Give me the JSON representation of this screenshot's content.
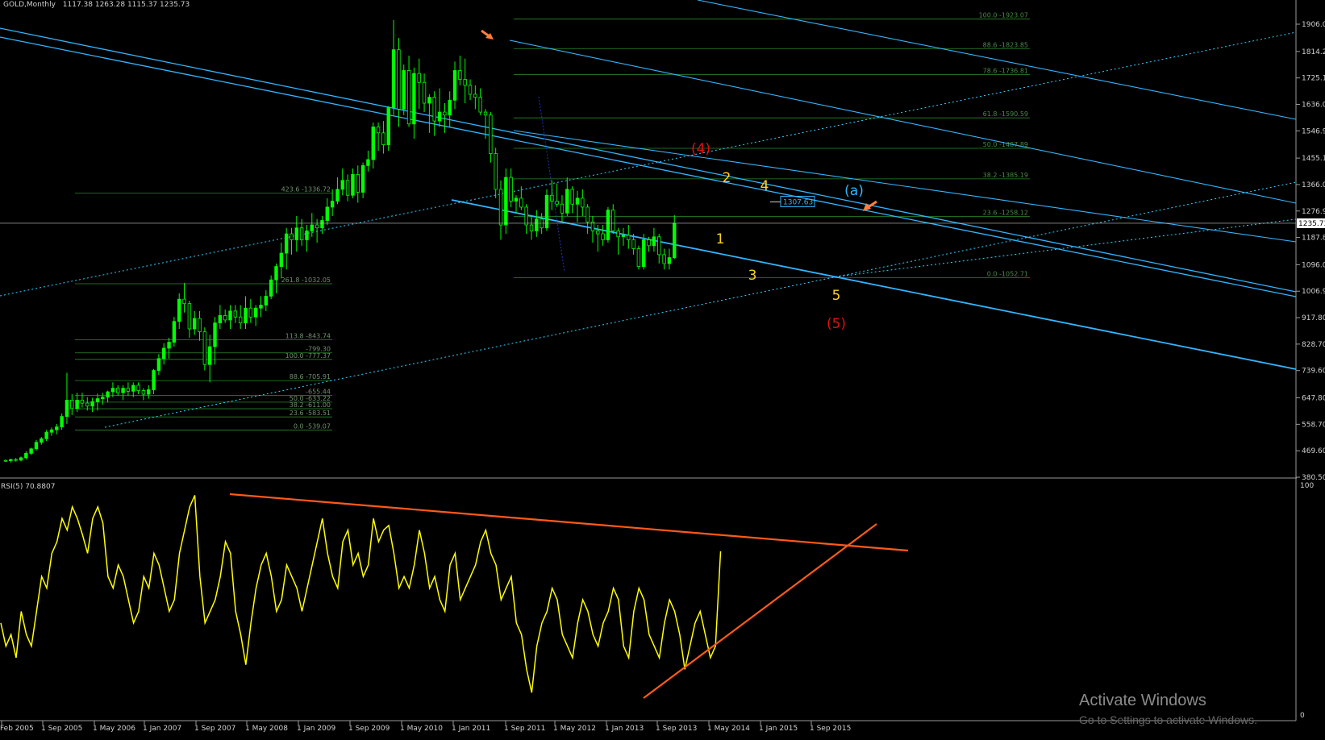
{
  "header": {
    "symbol_title": "GOLD,Monthly",
    "ohlc": "1117.38 1263.28 1115.37 1235.73"
  },
  "chart_data": [
    {
      "type": "candlestick",
      "title": "GOLD,Monthly",
      "price_axis_ticks": [
        "1906.00",
        "1814.20",
        "1725.10",
        "1636.00",
        "1546.90",
        "1455.10",
        "1366.00",
        "1276.90",
        "1187.80",
        "1096.00",
        "1006.90",
        "917.80",
        "828.70",
        "739.60",
        "647.80",
        "558.70",
        "469.60",
        "380.50"
      ],
      "current_price_label": "1235.73",
      "ylim": [
        380.5,
        1906.0
      ],
      "time_axis_ticks": [
        "Feb 2005",
        "1 Sep 2005",
        "1 May 2006",
        "1 Jan 2007",
        "1 Sep 2007",
        "1 May 2008",
        "1 Jan 2009",
        "1 Sep 2009",
        "1 May 2010",
        "1 Jan 2011",
        "1 Sep 2011",
        "1 May 2012",
        "1 Jan 2013",
        "1 Sep 2013",
        "1 May 2014",
        "1 Jan 2015",
        "1 Sep 2015"
      ],
      "fib_left": [
        {
          "label": "423.6 -1336.72",
          "price": 1336.72
        },
        {
          "label": "261.8 -1032.05",
          "price": 1032.05
        },
        {
          "label": "113.8 -843.74",
          "price": 843.74
        },
        {
          "label": "-799.30",
          "price": 799.3
        },
        {
          "label": "100.0 -777.37",
          "price": 777.37
        },
        {
          "label": "88.6 -705.91",
          "price": 705.91
        },
        {
          "label": "-655.44",
          "price": 655.44
        },
        {
          "label": "50.0 -633.22",
          "price": 633.22
        },
        {
          "label": "38.2 -611.00",
          "price": 611.0
        },
        {
          "label": "23.6 -583.51",
          "price": 583.51
        },
        {
          "label": "0.0 -539.07",
          "price": 539.07
        }
      ],
      "fib_right": [
        {
          "label": "100.0 -1923.07",
          "price": 1923.07
        },
        {
          "label": "88.6 -1823.85",
          "price": 1823.85
        },
        {
          "label": "78.6 -1736.81",
          "price": 1736.81
        },
        {
          "label": "61.8 -1590.59",
          "price": 1590.59
        },
        {
          "label": "50.0 -1487.89",
          "price": 1487.89
        },
        {
          "label": "38.2 -1385.19",
          "price": 1385.19
        },
        {
          "label": "23.6 -1258.12",
          "price": 1258.12
        },
        {
          "label": "0.0 -1052.71",
          "price": 1052.71
        }
      ],
      "price_boxes": [
        "1307.63"
      ],
      "wave_labels": [
        {
          "text": "(4)",
          "color": "#e01010"
        },
        {
          "text": "(5)",
          "color": "#e01010"
        },
        {
          "text": "(a)",
          "color": "#33b5ff"
        },
        {
          "text": "1",
          "color": "#ffd21f"
        },
        {
          "text": "2",
          "color": "#ffd21f"
        },
        {
          "text": "3",
          "color": "#ffd21f"
        },
        {
          "text": "4",
          "color": "#ffd21f"
        },
        {
          "text": "5",
          "color": "#ffd21f"
        }
      ],
      "candles": [
        [
          437,
          440,
          432,
          436
        ],
        [
          436,
          443,
          430,
          440
        ],
        [
          440,
          445,
          433,
          438
        ],
        [
          438,
          450,
          434,
          446
        ],
        [
          446,
          468,
          440,
          461
        ],
        [
          461,
          480,
          455,
          476
        ],
        [
          476,
          506,
          470,
          498
        ],
        [
          498,
          516,
          490,
          510
        ],
        [
          510,
          540,
          502,
          532
        ],
        [
          532,
          548,
          520,
          540
        ],
        [
          540,
          560,
          525,
          550
        ],
        [
          550,
          595,
          540,
          585
        ],
        [
          585,
          732,
          560,
          640
        ],
        [
          640,
          660,
          590,
          612
        ],
        [
          612,
          665,
          600,
          640
        ],
        [
          640,
          665,
          615,
          630
        ],
        [
          630,
          650,
          605,
          620
        ],
        [
          620,
          648,
          600,
          635
        ],
        [
          635,
          662,
          605,
          645
        ],
        [
          645,
          665,
          625,
          650
        ],
        [
          650,
          672,
          632,
          668
        ],
        [
          668,
          700,
          650,
          680
        ],
        [
          680,
          690,
          655,
          665
        ],
        [
          665,
          690,
          640,
          680
        ],
        [
          680,
          700,
          655,
          670
        ],
        [
          670,
          700,
          650,
          690
        ],
        [
          690,
          700,
          660,
          672
        ],
        [
          672,
          680,
          640,
          660
        ],
        [
          660,
          690,
          645,
          675
        ],
        [
          675,
          745,
          660,
          740
        ],
        [
          740,
          795,
          725,
          780
        ],
        [
          780,
          832,
          760,
          815
        ],
        [
          815,
          850,
          780,
          835
        ],
        [
          835,
          920,
          820,
          905
        ],
        [
          905,
          1000,
          880,
          980
        ],
        [
          980,
          1035,
          935,
          965
        ],
        [
          965,
          975,
          850,
          880
        ],
        [
          880,
          940,
          860,
          915
        ],
        [
          915,
          940,
          840,
          870
        ],
        [
          870,
          885,
          740,
          760
        ],
        [
          760,
          860,
          700,
          820
        ],
        [
          820,
          920,
          760,
          900
        ],
        [
          900,
          960,
          880,
          925
        ],
        [
          925,
          945,
          900,
          910
        ],
        [
          910,
          960,
          880,
          940
        ],
        [
          940,
          960,
          900,
          920
        ],
        [
          920,
          960,
          880,
          900
        ],
        [
          900,
          990,
          880,
          950
        ],
        [
          950,
          980,
          900,
          920
        ],
        [
          920,
          960,
          890,
          950
        ],
        [
          950,
          990,
          920,
          960
        ],
        [
          960,
          1010,
          940,
          990
        ],
        [
          990,
          1060,
          980,
          1045
        ],
        [
          1045,
          1100,
          1000,
          1090
        ],
        [
          1090,
          1170,
          1050,
          1135
        ],
        [
          1135,
          1220,
          1080,
          1200
        ],
        [
          1200,
          1220,
          1130,
          1180
        ],
        [
          1180,
          1260,
          1140,
          1220
        ],
        [
          1220,
          1250,
          1160,
          1180
        ],
        [
          1180,
          1230,
          1140,
          1210
        ],
        [
          1210,
          1270,
          1190,
          1230
        ],
        [
          1230,
          1250,
          1170,
          1220
        ],
        [
          1220,
          1260,
          1200,
          1245
        ],
        [
          1245,
          1320,
          1230,
          1290
        ],
        [
          1290,
          1350,
          1260,
          1310
        ],
        [
          1310,
          1390,
          1300,
          1350
        ],
        [
          1350,
          1420,
          1330,
          1380
        ],
        [
          1380,
          1400,
          1310,
          1330
        ],
        [
          1330,
          1420,
          1320,
          1400
        ],
        [
          1400,
          1430,
          1305,
          1340
        ],
        [
          1340,
          1440,
          1320,
          1430
        ],
        [
          1430,
          1480,
          1410,
          1450
        ],
        [
          1450,
          1575,
          1420,
          1560
        ],
        [
          1560,
          1575,
          1480,
          1540
        ],
        [
          1540,
          1580,
          1470,
          1500
        ],
        [
          1500,
          1630,
          1480,
          1625
        ],
        [
          1625,
          1920,
          1600,
          1820
        ],
        [
          1820,
          1860,
          1560,
          1620
        ],
        [
          1620,
          1770,
          1600,
          1750
        ],
        [
          1750,
          1800,
          1560,
          1570
        ],
        [
          1570,
          1760,
          1520,
          1740
        ],
        [
          1740,
          1790,
          1620,
          1710
        ],
        [
          1710,
          1740,
          1610,
          1640
        ],
        [
          1640,
          1670,
          1540,
          1660
        ],
        [
          1660,
          1680,
          1530,
          1580
        ],
        [
          1580,
          1690,
          1560,
          1610
        ],
        [
          1610,
          1640,
          1540,
          1600
        ],
        [
          1600,
          1680,
          1560,
          1650
        ],
        [
          1650,
          1780,
          1620,
          1750
        ],
        [
          1750,
          1800,
          1700,
          1720
        ],
        [
          1720,
          1790,
          1640,
          1700
        ],
        [
          1700,
          1720,
          1650,
          1670
        ],
        [
          1670,
          1700,
          1620,
          1660
        ],
        [
          1660,
          1690,
          1600,
          1610
        ],
        [
          1610,
          1620,
          1520,
          1600
        ],
        [
          1600,
          1610,
          1440,
          1470
        ],
        [
          1470,
          1490,
          1320,
          1350
        ],
        [
          1350,
          1380,
          1180,
          1230
        ],
        [
          1230,
          1420,
          1200,
          1390
        ],
        [
          1390,
          1420,
          1290,
          1310
        ],
        [
          1310,
          1330,
          1270,
          1320
        ],
        [
          1320,
          1360,
          1280,
          1290
        ],
        [
          1290,
          1300,
          1200,
          1230
        ],
        [
          1230,
          1260,
          1180,
          1210
        ],
        [
          1210,
          1280,
          1190,
          1250
        ],
        [
          1250,
          1270,
          1200,
          1220
        ],
        [
          1220,
          1350,
          1210,
          1330
        ],
        [
          1330,
          1380,
          1280,
          1310
        ],
        [
          1310,
          1370,
          1290,
          1300
        ],
        [
          1300,
          1330,
          1240,
          1270
        ],
        [
          1270,
          1390,
          1260,
          1350
        ],
        [
          1350,
          1360,
          1270,
          1300
        ],
        [
          1300,
          1345,
          1240,
          1320
        ],
        [
          1320,
          1350,
          1260,
          1290
        ],
        [
          1290,
          1300,
          1200,
          1240
        ],
        [
          1240,
          1260,
          1170,
          1210
        ],
        [
          1210,
          1230,
          1140,
          1200
        ],
        [
          1200,
          1230,
          1160,
          1180
        ],
        [
          1180,
          1290,
          1170,
          1280
        ],
        [
          1280,
          1300,
          1200,
          1210
        ],
        [
          1210,
          1220,
          1130,
          1190
        ],
        [
          1190,
          1220,
          1160,
          1195
        ],
        [
          1195,
          1230,
          1150,
          1180
        ],
        [
          1180,
          1200,
          1130,
          1150
        ],
        [
          1150,
          1160,
          1080,
          1090
        ],
        [
          1090,
          1200,
          1080,
          1180
        ],
        [
          1180,
          1190,
          1140,
          1160
        ],
        [
          1160,
          1220,
          1140,
          1190
        ],
        [
          1190,
          1200,
          1100,
          1130
        ],
        [
          1130,
          1150,
          1080,
          1100
        ],
        [
          1100,
          1150,
          1080,
          1120
        ],
        [
          1120,
          1263,
          1115,
          1236
        ]
      ]
    },
    {
      "type": "line",
      "title": "RSI(5) 70.8807",
      "ylim": [
        0,
        100
      ],
      "y_ticks": [
        "100",
        "0"
      ],
      "values": [
        40,
        30,
        35,
        25,
        45,
        35,
        30,
        45,
        60,
        55,
        70,
        75,
        85,
        80,
        90,
        85,
        78,
        70,
        85,
        90,
        83,
        60,
        55,
        65,
        60,
        50,
        40,
        45,
        60,
        55,
        70,
        65,
        55,
        45,
        50,
        70,
        80,
        90,
        95,
        60,
        40,
        45,
        50,
        60,
        75,
        70,
        45,
        35,
        22,
        40,
        55,
        65,
        70,
        60,
        45,
        50,
        65,
        60,
        55,
        45,
        55,
        65,
        75,
        85,
        70,
        60,
        55,
        75,
        80,
        65,
        70,
        60,
        65,
        85,
        75,
        80,
        82,
        70,
        55,
        60,
        55,
        65,
        80,
        70,
        55,
        60,
        50,
        45,
        65,
        70,
        50,
        55,
        60,
        65,
        75,
        80,
        70,
        65,
        50,
        55,
        60,
        40,
        35,
        20,
        10,
        30,
        40,
        45,
        55,
        50,
        35,
        30,
        25,
        40,
        50,
        45,
        35,
        30,
        40,
        45,
        55,
        50,
        30,
        25,
        45,
        55,
        50,
        35,
        30,
        25,
        40,
        50,
        45,
        35,
        20,
        30,
        40,
        45,
        35,
        25,
        30,
        70.88
      ],
      "trendlines": [
        {
          "type": "resistance",
          "color": "#ff5a1a"
        },
        {
          "type": "support",
          "color": "#ff5a1a"
        }
      ]
    }
  ],
  "watermark": {
    "line1": "Activate Windows",
    "line2": "Go to Settings to activate Windows."
  },
  "colors": {
    "bull_candle": "#00ff00",
    "bear_candle": "#000000",
    "channel": "#33b5ff",
    "fib": "#2a8a2a",
    "rsi": "#ffff00",
    "trend": "#ff5a1a"
  }
}
